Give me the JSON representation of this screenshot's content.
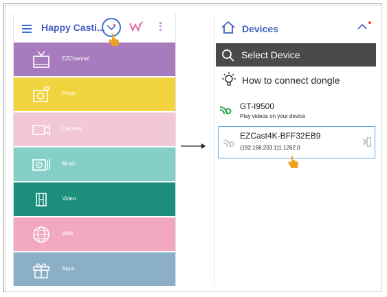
{
  "left_screen": {
    "title": "Happy Casti...",
    "tiles": [
      {
        "label": "EZChannel",
        "color": "#a87bbf",
        "icon": "tv-icon"
      },
      {
        "label": "Photo",
        "color": "#f2d340",
        "icon": "photo-icon"
      },
      {
        "label": "Camera",
        "color": "#f2c8d4",
        "icon": "camera-icon"
      },
      {
        "label": "Music",
        "color": "#86cfc8",
        "icon": "music-icon"
      },
      {
        "label": "Video",
        "color": "#1b8f7b",
        "icon": "film-icon"
      },
      {
        "label": "Web",
        "color": "#f1a8c0",
        "icon": "globe-icon"
      },
      {
        "label": "Apps",
        "color": "#8aafc6",
        "icon": "gift-icon"
      }
    ]
  },
  "right_screen": {
    "title": "Devices",
    "select_label": "Select Device",
    "howto_label": "How to connect dongle",
    "devices": [
      {
        "name": "GT-I9500",
        "subtitle": "Play videos on your device"
      },
      {
        "name": "EZCast4K-BFF32EB9",
        "subtitle": "(192.168.203.1)1.1262.0"
      }
    ]
  },
  "colors": {
    "accent_blue": "#3f5ec2",
    "select_bar": "#4a4a4a",
    "highlight_border": "#5aa7e0",
    "hand": "#f0a020"
  }
}
